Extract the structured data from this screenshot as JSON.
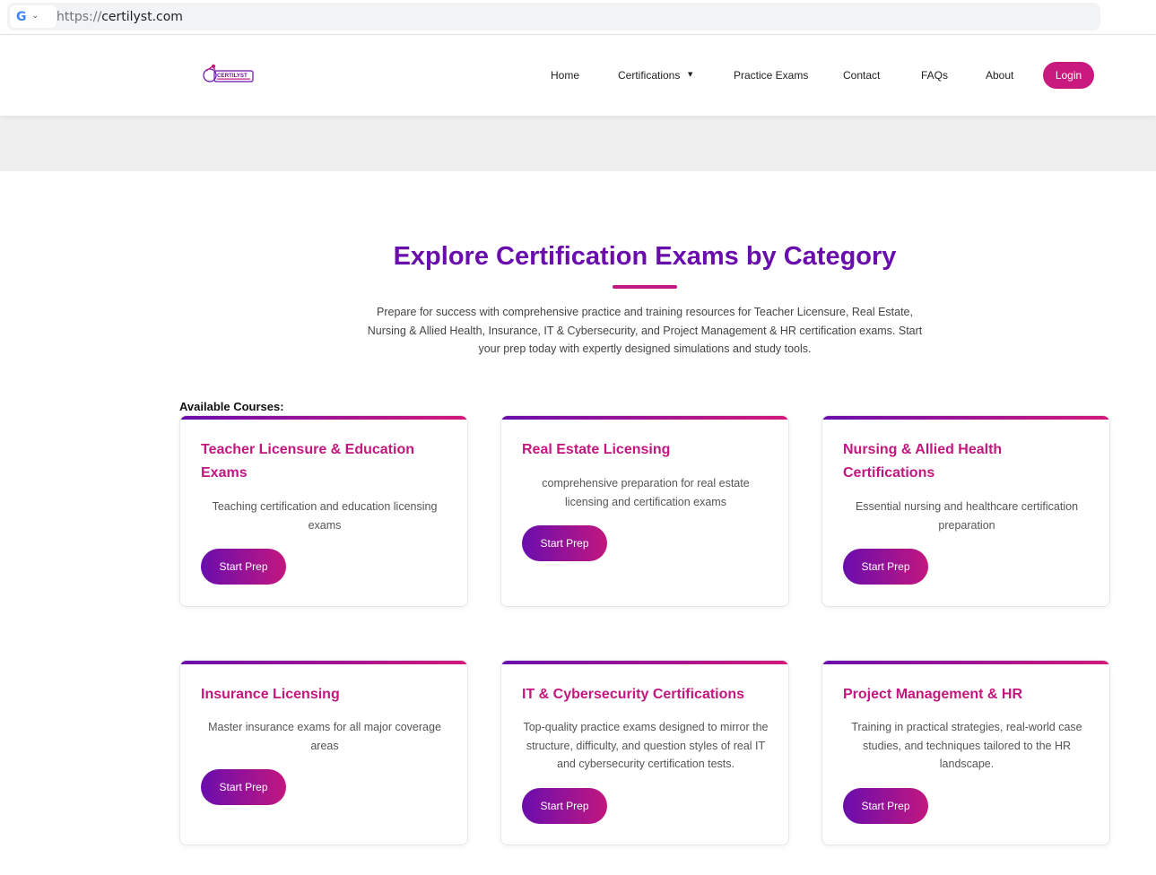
{
  "browser": {
    "url_scheme": "https://",
    "url_host": "certilyst.com"
  },
  "header": {
    "logo_text": "CERTILYST",
    "nav": {
      "home": "Home",
      "certifications": "Certifications",
      "practice_exams": "Practice Exams",
      "contact": "Contact",
      "faqs": "FAQs",
      "about": "About",
      "login": "Login"
    }
  },
  "hero": {
    "title": "Explore Certification Exams by Category",
    "description": "Prepare for success with comprehensive practice and training resources for Teacher Licensure, Real Estate, Nursing & Allied Health, Insurance, IT & Cybersecurity, and Project Management & HR certification exams. Start your prep today with expertly designed simulations and study tools."
  },
  "courses": {
    "label": "Available Courses:",
    "button_label": "Start Prep",
    "items": [
      {
        "title": "Teacher Licensure & Education Exams",
        "description": "Teaching certification and education licensing exams"
      },
      {
        "title": "Real Estate Licensing",
        "description": "comprehensive preparation for real estate licensing and certification exams"
      },
      {
        "title": "Nursing & Allied Health Certifications",
        "description": "Essential nursing and healthcare certification preparation"
      },
      {
        "title": "Insurance Licensing",
        "description": "Master insurance exams for all major coverage areas"
      },
      {
        "title": "IT & Cybersecurity Certifications",
        "description": "Top-quality practice exams designed to mirror the structure, difficulty, and question styles of real IT and cybersecurity certification tests."
      },
      {
        "title": "Project Management & HR",
        "description": "Training in practical strategies, real-world case studies, and techniques tailored to the HR landscape."
      }
    ]
  },
  "colors": {
    "primary_purple": "#6a0dad",
    "accent_magenta": "#c2177f",
    "login_pink": "#c81a7e"
  }
}
